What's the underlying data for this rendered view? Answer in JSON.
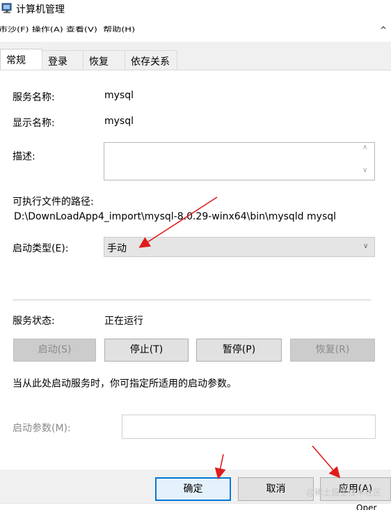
{
  "window": {
    "title": "计算机管理",
    "menu_partial": "市沙(F) 操作(A) 查看(V)  帮助(H)",
    "collapse_glyph": "^"
  },
  "tabs": [
    {
      "label": "常规",
      "active": true
    },
    {
      "label": "登录",
      "active": false
    },
    {
      "label": "恢复",
      "active": false
    },
    {
      "label": "依存关系",
      "active": false
    }
  ],
  "general": {
    "service_name_label": "服务名称:",
    "service_name_value": "mysql",
    "display_name_label": "显示名称:",
    "display_name_value": "mysql",
    "description_label": "描述:",
    "description_value": "",
    "exec_path_label": "可执行文件的路径:",
    "exec_path_value": "D:\\DownLoadApp4_import\\mysql-8.0.29-winx64\\bin\\mysqld mysql",
    "startup_type_label": "启动类型(E):",
    "startup_type_value": "手动",
    "status_label": "服务状态:",
    "status_value": "正在运行",
    "buttons": {
      "start": "启动(S)",
      "stop": "停止(T)",
      "pause": "暂停(P)",
      "resume": "恢复(R)"
    },
    "hint": "当从此处启动服务时，你可指定所适用的启动参数。",
    "start_params_label": "启动参数(M):",
    "start_params_value": ""
  },
  "footer": {
    "ok": "确定",
    "cancel": "取消",
    "apply": "应用(A)"
  },
  "background": {
    "open_text": "Oper"
  },
  "watermark": "@稀土掘金技术社区",
  "colors": {
    "annotation_arrow": "#e01b1b",
    "default_button_border": "#0078d7"
  }
}
